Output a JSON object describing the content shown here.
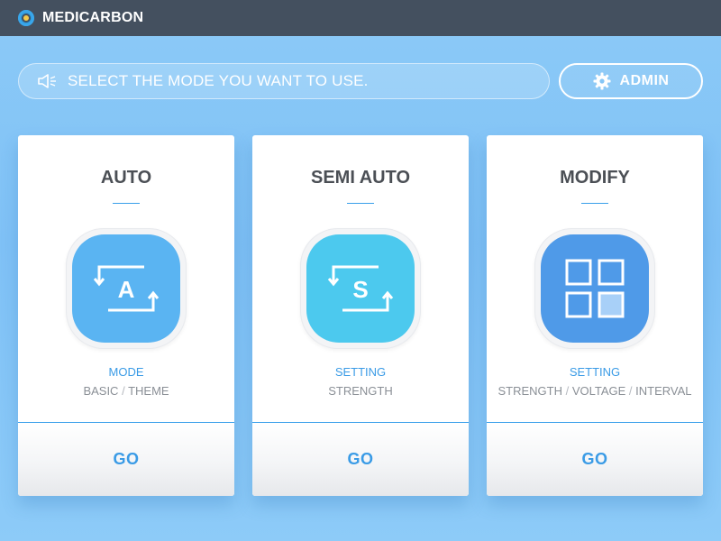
{
  "app": {
    "title": "MEDICARBON"
  },
  "notice": {
    "text": "SELECT THE MODE YOU WANT TO USE."
  },
  "admin": {
    "label": "ADMIN"
  },
  "colors": {
    "topbar": "#44505f",
    "accent": "#3a9be6",
    "auto_tile": "#5ab4f2",
    "semi_tile": "#4cc9ee",
    "modify_tile": "#4f9ae8"
  },
  "cards": [
    {
      "title": "AUTO",
      "icon": "auto-mode-icon",
      "icon_letter": "A",
      "category": "MODE",
      "details": [
        "BASIC",
        "THEME"
      ],
      "go_label": "GO"
    },
    {
      "title": "SEMI AUTO",
      "icon": "semi-auto-mode-icon",
      "icon_letter": "S",
      "category": "SETTING",
      "details": [
        "STRENGTH"
      ],
      "go_label": "GO"
    },
    {
      "title": "MODIFY",
      "icon": "grid-icon",
      "category": "SETTING",
      "details": [
        "STRENGTH",
        "VOLTAGE",
        "INTERVAL"
      ],
      "go_label": "GO"
    }
  ]
}
